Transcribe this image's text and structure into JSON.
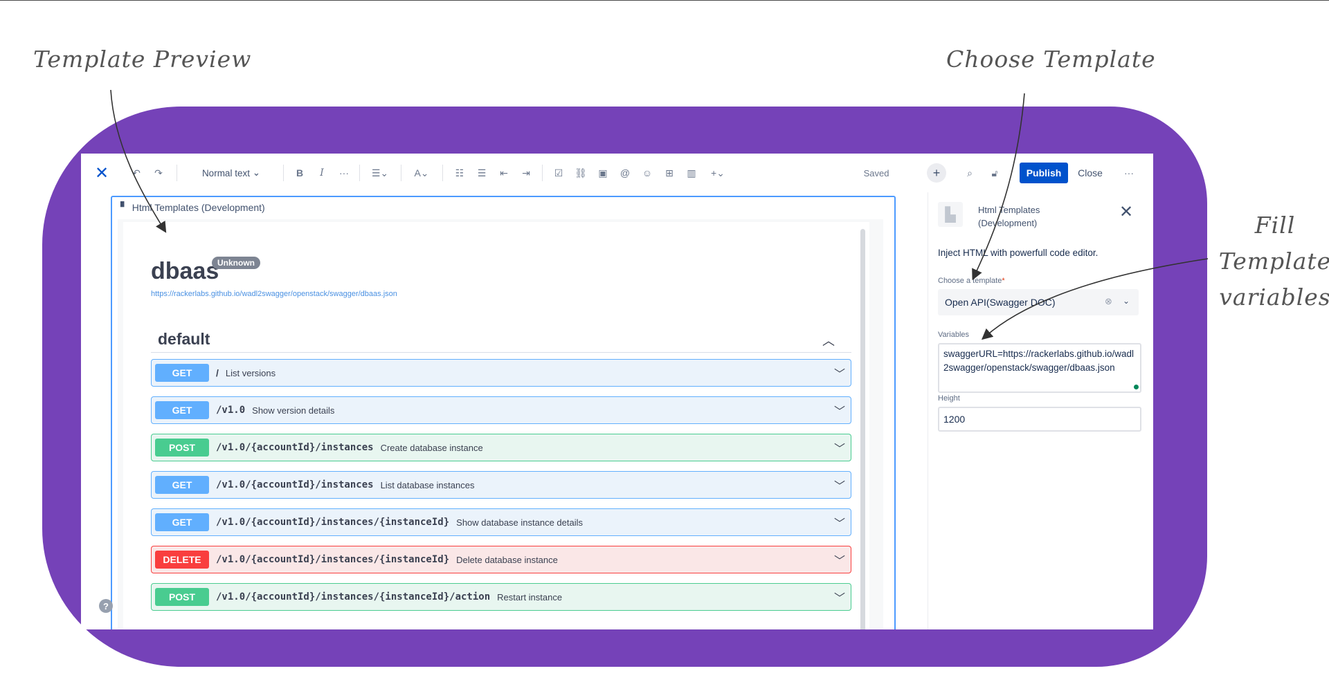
{
  "annotations": {
    "template_preview": "Template Preview",
    "choose_template": "Choose Template",
    "fill_line1": "Fill",
    "fill_line2": "Template",
    "fill_line3": "variables"
  },
  "toolbar": {
    "text_style": "Normal text",
    "bold": "B",
    "italic": "I",
    "more": "···",
    "saved": "Saved",
    "publish": "Publish",
    "close": "Close",
    "overflow": "···"
  },
  "macro": {
    "title": "Html Templates (Development)"
  },
  "swagger": {
    "title": "dbaas",
    "badge": "Unknown",
    "url": "https://rackerlabs.github.io/wadl2swagger/openstack/swagger/dbaas.json",
    "section": "default",
    "operations": [
      {
        "method": "GET",
        "type": "get",
        "path": "/",
        "summary": "List versions",
        "mono": false
      },
      {
        "method": "GET",
        "type": "get",
        "path": "/v1.0",
        "summary": "Show version details",
        "mono": true
      },
      {
        "method": "POST",
        "type": "post",
        "path": "/v1.0/{accountId}/instances",
        "summary": "Create database instance",
        "mono": true
      },
      {
        "method": "GET",
        "type": "get",
        "path": "/v1.0/{accountId}/instances",
        "summary": "List database instances",
        "mono": true
      },
      {
        "method": "GET",
        "type": "get",
        "path": "/v1.0/{accountId}/instances/{instanceId}",
        "summary": "Show database instance details",
        "mono": true
      },
      {
        "method": "DELETE",
        "type": "delete",
        "path": "/v1.0/{accountId}/instances/{instanceId}",
        "summary": "Delete database instance",
        "mono": true
      },
      {
        "method": "POST",
        "type": "post",
        "path": "/v1.0/{accountId}/instances/{instanceId}/action",
        "summary": "Restart instance",
        "mono": true
      }
    ]
  },
  "panel": {
    "title": "Html Templates (Development)",
    "description": "Inject HTML with powerfull code editor.",
    "template_label": "Choose a template",
    "template_required": "*",
    "template_value": "Open API(Swagger DOC)",
    "variables_label": "Variables",
    "variables_value": "swaggerURL=https://rackerlabs.github.io/wadl2swagger/openstack/swagger/dbaas.json",
    "height_label": "Height",
    "height_value": "1200"
  },
  "help": "?",
  "colors": {
    "frame": "#7542b8",
    "primary": "#0052cc",
    "get": "#61affe",
    "post": "#49cc90",
    "delete": "#f93e3e"
  }
}
